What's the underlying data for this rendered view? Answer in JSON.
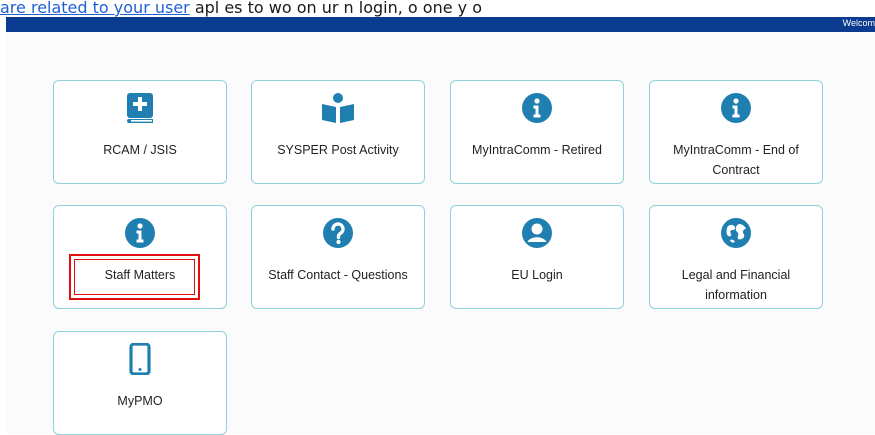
{
  "header": {
    "top_link_text": "are related to your user",
    "top_text": " apl es to wo  on  ur n  login, o  one  y o",
    "welcome": "Welcom",
    "colors": {
      "bar": "#0b3b8f",
      "tile_border": "#8fd1dc",
      "icon": "#1f7fb0",
      "highlight": "#e01010"
    }
  },
  "tiles": [
    {
      "label": "RCAM / JSIS",
      "icon": "medical-book-icon"
    },
    {
      "label": "SYSPER Post Activity",
      "icon": "person-reading-icon"
    },
    {
      "label": "MyIntraComm - Retired",
      "icon": "info-icon"
    },
    {
      "label": "MyIntraComm - End of Contract",
      "icon": "info-icon"
    },
    {
      "label": "Staff Matters",
      "icon": "info-icon",
      "highlighted": true
    },
    {
      "label": "Staff Contact - Questions",
      "icon": "question-icon"
    },
    {
      "label": "EU Login",
      "icon": "user-icon"
    },
    {
      "label": "Legal and Financial information",
      "icon": "globe-icon"
    },
    {
      "label": "MyPMO",
      "icon": "mobile-icon"
    }
  ]
}
